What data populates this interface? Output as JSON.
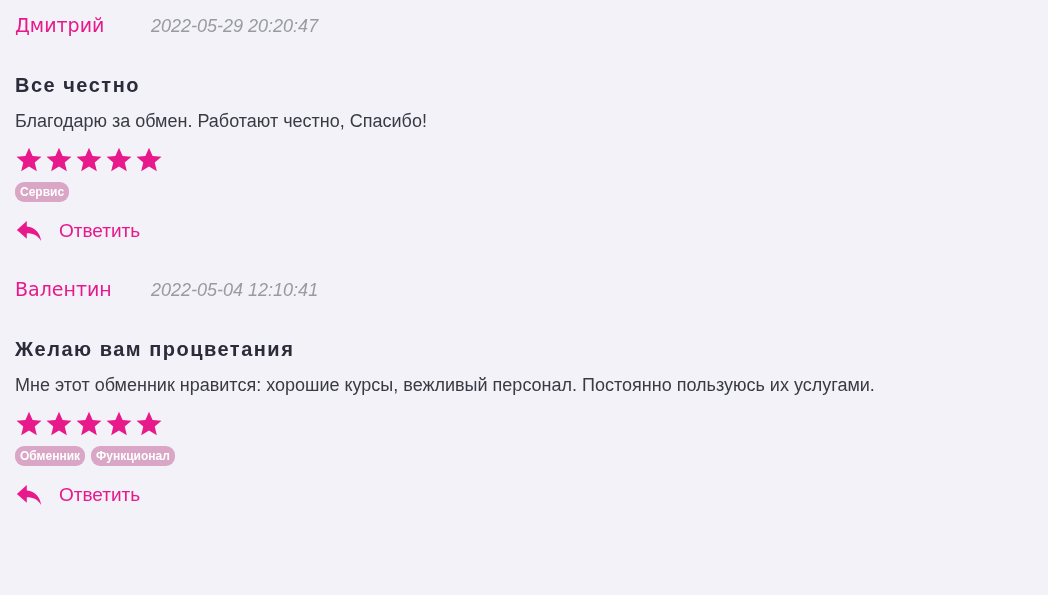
{
  "reviews": [
    {
      "author": "Дмитрий",
      "date": "2022-05-29 20:20:47",
      "title": "Все честно",
      "text": "Благодарю за обмен. Работают честно, Спасибо!",
      "stars": 5,
      "tags": [
        "Сервис"
      ],
      "reply": "Ответить"
    },
    {
      "author": "Валентин",
      "date": "2022-05-04 12:10:41",
      "title": "Желаю вам процветания",
      "text": "Мне этот обменник нравится: хорошие курсы, вежливый персонал. Постоянно пользуюсь их услугами.",
      "stars": 5,
      "tags": [
        "Обменник",
        "Функционал"
      ],
      "reply": "Ответить"
    }
  ]
}
